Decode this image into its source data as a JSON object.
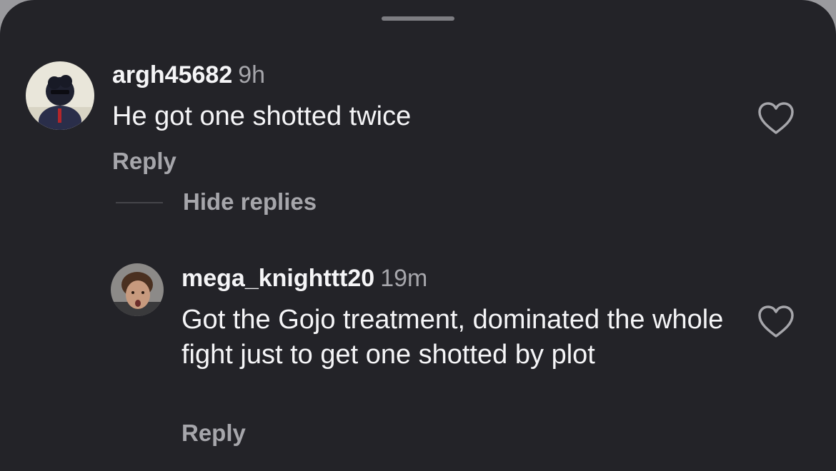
{
  "comments": [
    {
      "username": "argh45682",
      "time": "9h",
      "text": "He got one shotted twice",
      "reply_label": "Reply"
    },
    {
      "username": "mega_knighttt20",
      "time": "19m",
      "text": "Got the Gojo treatment, dominated the whole fight just to get one shotted by plot",
      "reply_label": "Reply"
    }
  ],
  "thread": {
    "hide_replies_label": "Hide replies"
  },
  "icons": {
    "like": "heart-outline-icon",
    "grabber": "sheet-grabber"
  },
  "colors": {
    "background": "#232328",
    "primary_text": "#f5f5f7",
    "secondary_text": "#a6a6ab"
  }
}
